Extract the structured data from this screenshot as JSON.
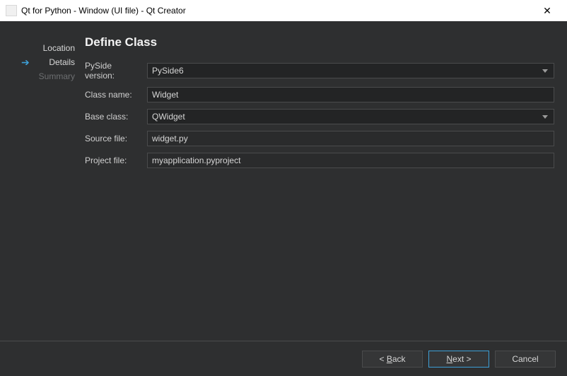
{
  "window": {
    "title": "Qt for Python - Window (UI file) - Qt Creator"
  },
  "sidebar": {
    "steps": [
      {
        "label": "Location",
        "active": false,
        "disabled": false
      },
      {
        "label": "Details",
        "active": true,
        "disabled": false
      },
      {
        "label": "Summary",
        "active": false,
        "disabled": true
      }
    ]
  },
  "heading": "Define Class",
  "form": {
    "pyside_version": {
      "label": "PySide version:",
      "value": "PySide6"
    },
    "class_name": {
      "label": "Class name:",
      "value": "Widget"
    },
    "base_class": {
      "label": "Base class:",
      "value": "QWidget"
    },
    "source_file": {
      "label": "Source file:",
      "value": "widget.py"
    },
    "project_file": {
      "label": "Project file:",
      "value": "myapplication.pyproject"
    }
  },
  "buttons": {
    "back": "< Back",
    "next_prefix": "N",
    "next_suffix": "ext >",
    "cancel": "Cancel"
  }
}
